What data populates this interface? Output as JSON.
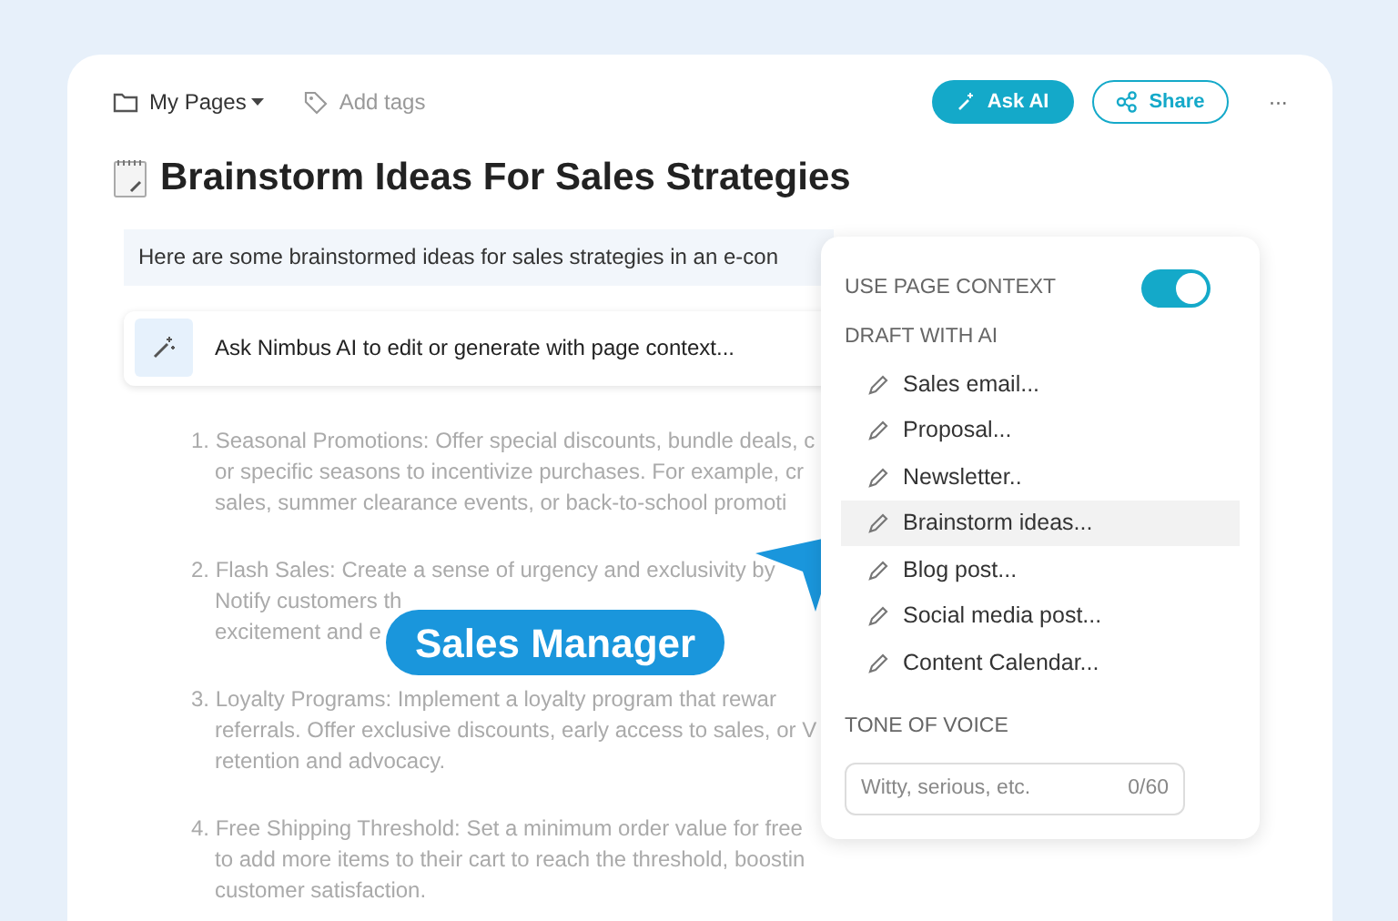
{
  "toolbar": {
    "folder": "My Pages",
    "tags_placeholder": "Add tags",
    "ask_ai": "Ask AI",
    "share": "Share",
    "more": "···"
  },
  "title": "Brainstorm Ideas For Sales Strategies",
  "intro": "Here are some brainstormed ideas for sales strategies in an e-con",
  "ai_prompt": {
    "placeholder": "Ask Nimbus AI to edit or generate with page context..."
  },
  "list_items": [
    {
      "lines": [
        "1. Seasonal Promotions: Offer special discounts, bundle deals, c",
        "or specific seasons to incentivize purchases. For example, cr",
        "sales, summer clearance events, or back-to-school promoti"
      ]
    },
    {
      "lines": [
        "2. Flash Sales: Create a sense of urgency and exclusivity by",
        "Notify customers th",
        "excitement and e"
      ]
    },
    {
      "lines": [
        "3. Loyalty Programs: Implement a loyalty program that rewar",
        "referrals. Offer exclusive discounts, early access to sales, or V",
        "retention and advocacy."
      ]
    },
    {
      "lines": [
        "4. Free Shipping Threshold: Set a minimum order value for free",
        "to add more items to their cart to reach the threshold, boostin",
        "customer satisfaction."
      ]
    }
  ],
  "badge": "Sales Manager",
  "popup": {
    "context_label": "USE PAGE CONTEXT",
    "use_page_context": true,
    "draft_label": "DRAFT WITH AI",
    "items": [
      {
        "label": "Sales email...",
        "selected": false
      },
      {
        "label": "Proposal...",
        "selected": false
      },
      {
        "label": "Newsletter..",
        "selected": false
      },
      {
        "label": "Brainstorm ideas...",
        "selected": true
      },
      {
        "label": "Blog post...",
        "selected": false
      },
      {
        "label": "Social media post...",
        "selected": false
      },
      {
        "label": "Content Calendar...",
        "selected": false
      }
    ],
    "tone_label": "TONE OF VOICE",
    "tone_placeholder": "Witty, serious, etc.",
    "tone_counter": "0/60"
  }
}
